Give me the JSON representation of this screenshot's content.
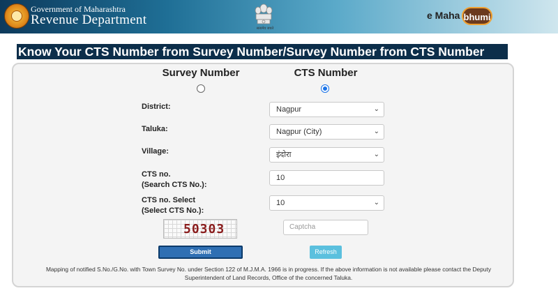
{
  "header": {
    "gov_name": "Government of Maharashtra",
    "dept_name": "Revenue Department",
    "emblem_caption": "सत्यमेव जयते",
    "brand_prefix": "e Maha",
    "brand_name": "bhumi"
  },
  "banner": {
    "title": "Know Your CTS Number from Survey Number/Survey Number from CTS Number"
  },
  "mode": {
    "options": [
      {
        "label": "Survey Number",
        "selected": false
      },
      {
        "label": "CTS Number",
        "selected": true
      }
    ]
  },
  "form": {
    "district": {
      "label": "District:",
      "value": "Nagpur"
    },
    "taluka": {
      "label": "Taluka:",
      "value": "Nagpur (City)"
    },
    "village": {
      "label": "Village:",
      "value": "इंदोरा"
    },
    "cts_search": {
      "label_line1": "CTS no.",
      "label_line2": "(Search CTS No.):",
      "value": "10"
    },
    "cts_select": {
      "label_line1": "CTS no. Select",
      "label_line2": "(Select CTS No.):",
      "value": "10"
    },
    "captcha": {
      "image_text": "50303",
      "placeholder": "Captcha"
    }
  },
  "buttons": {
    "submit": "Submit",
    "refresh": "Refresh"
  },
  "notice": "Mapping of notified S.No./G.No. with Town Survey No. under Section 122 of M.J.M.A. 1966 is in progress. If the above information is not available please contact the Deputy Superintendent of Land Records, Office of the concerned Taluka.",
  "colors": {
    "banner_bg": "#0c2e4a",
    "submit_bg": "#2f6fb3",
    "refresh_bg": "#5bc0de",
    "radio_accent": "#1a73e8"
  },
  "icons": {
    "dropdown": "chevron-down-icon",
    "state_emblem": "maharashtra-seal-icon",
    "national_emblem": "ashoka-emblem-icon"
  }
}
